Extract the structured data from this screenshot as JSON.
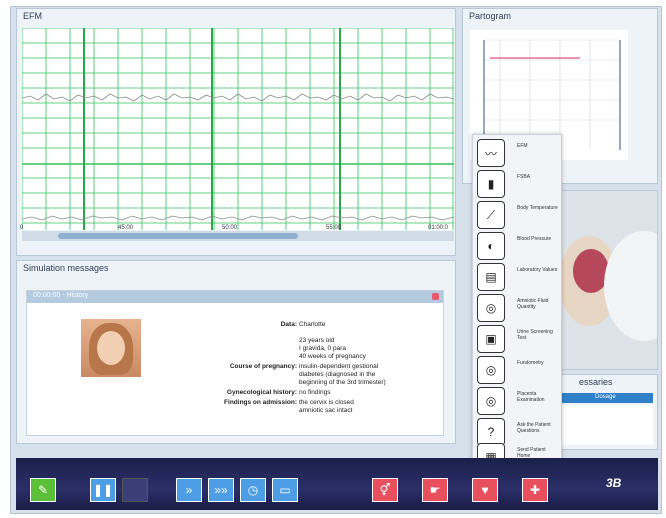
{
  "panels": {
    "efm_title": "EFM",
    "partogram_title": "Partogram",
    "simulation_title": "Simulation messages",
    "medications_title": "essaries",
    "medications_col": "Dosage"
  },
  "efm": {
    "time_labels": [
      "0",
      "45:00",
      "50:00",
      "55:00",
      "01:00:0"
    ]
  },
  "message": {
    "header": "00:00:00 - History",
    "data_label": "Data:",
    "data_value": "Charlotte",
    "age": "23 years old",
    "gravida": "I gravida, 0 para",
    "weeks": "40 weeks of pregnancy",
    "course_label": "Course of pregnancy:",
    "course_value_1": "insulin-dependent gestional",
    "course_value_2": "diabetes (diagnosed in the",
    "course_value_3": "beginning of the 3rd trimester)",
    "gyn_label": "Gynecological history:",
    "gyn_value": "no findings",
    "findings_label": "Findings on admission:",
    "findings_value_1": "the cervix is closed",
    "findings_value_2": "amniotic sac intact"
  },
  "menu": {
    "items": [
      {
        "label": "EFM",
        "icon": "ctg-wave-icon"
      },
      {
        "label": "FSBA",
        "icon": "test-tube-icon"
      },
      {
        "label": "Body Temperature",
        "icon": "thermometer-icon"
      },
      {
        "label": "Blood Pressure",
        "icon": "blood-pressure-icon"
      },
      {
        "label": "Laboratory Values",
        "icon": "clipboard-icon"
      },
      {
        "label": "Amniotic Fluid Quantity",
        "icon": "ultrasound-icon"
      },
      {
        "label": "Urine Screening Test",
        "icon": "urine-cup-icon"
      },
      {
        "label": "Fundometry",
        "icon": "fundometry-icon"
      },
      {
        "label": "Placenta Examination",
        "icon": "placenta-icon"
      },
      {
        "label": "Ask the Patient Questions",
        "icon": "question-person-icon"
      },
      {
        "label": "Send Patient Home",
        "icon": "calendar-icon"
      }
    ]
  },
  "toolbar": {
    "logo": "3B"
  }
}
